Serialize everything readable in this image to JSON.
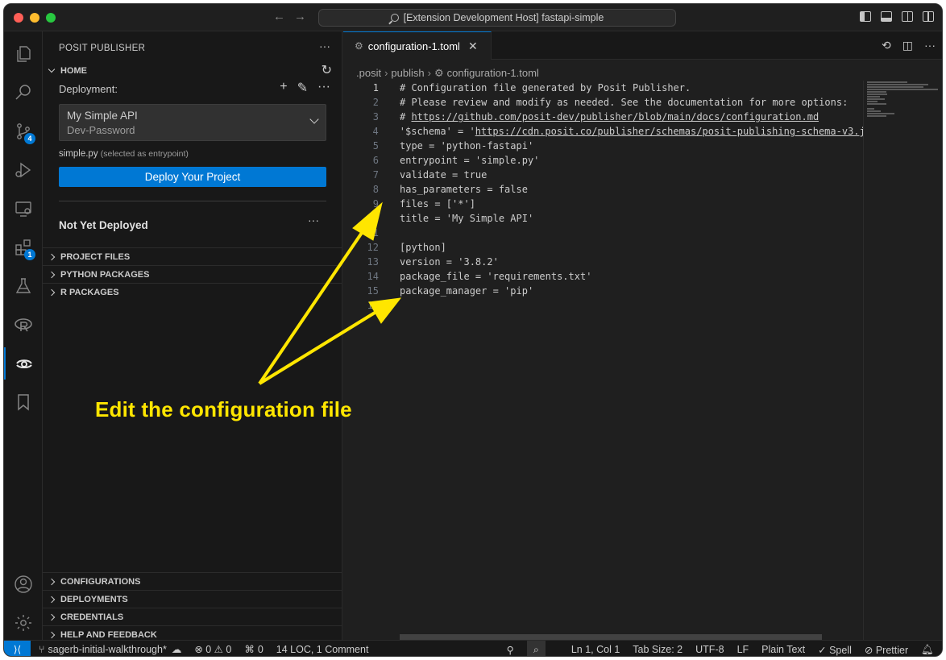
{
  "titlebar": {
    "title": "[Extension Development Host] fastapi-simple",
    "back_icon": "arrow-left-icon",
    "forward_icon": "arrow-right-icon"
  },
  "activity_bar": {
    "items": [
      {
        "icon": "explorer-icon"
      },
      {
        "icon": "search-icon"
      },
      {
        "icon": "source-control-icon",
        "badge": "4"
      },
      {
        "icon": "run-debug-icon"
      },
      {
        "icon": "remote-explorer-icon"
      },
      {
        "icon": "extensions-icon",
        "badge": "1"
      },
      {
        "icon": "testing-icon"
      },
      {
        "icon": "r-icon"
      },
      {
        "icon": "posit-publisher-icon"
      },
      {
        "icon": "bookmark-icon"
      }
    ],
    "bottom": [
      {
        "icon": "account-icon"
      },
      {
        "icon": "settings-gear-icon"
      }
    ]
  },
  "sidebar": {
    "title": "POSIT PUBLISHER",
    "home": {
      "label": "HOME",
      "deployment_label": "Deployment:",
      "selected_deployment": {
        "name": "My Simple API",
        "credential": "Dev-Password"
      },
      "entrypoint_file": "simple.py",
      "entrypoint_note": "(selected as entrypoint)",
      "deploy_button": "Deploy Your Project",
      "status": "Not Yet Deployed"
    },
    "sections_top": [
      "PROJECT FILES",
      "PYTHON PACKAGES",
      "R PACKAGES"
    ],
    "sections_bottom": [
      "CONFIGURATIONS",
      "DEPLOYMENTS",
      "CREDENTIALS",
      "HELP AND FEEDBACK"
    ]
  },
  "editor": {
    "tab": {
      "label": "configuration-1.toml"
    },
    "breadcrumb": [
      ".posit",
      "publish",
      "configuration-1.toml"
    ],
    "lines": [
      "# Configuration file generated by Posit Publisher.",
      "# Please review and modify as needed. See the documentation for more options:",
      "# https://github.com/posit-dev/publisher/blob/main/docs/configuration.md",
      "'$schema' = 'https://cdn.posit.co/publisher/schemas/posit-publishing-schema-v3.j",
      "type = 'python-fastapi'",
      "entrypoint = 'simple.py'",
      "validate = true",
      "has_parameters = false",
      "files = ['*']",
      "title = 'My Simple API'",
      "",
      "[python]",
      "version = '3.8.2'",
      "package_file = 'requirements.txt'",
      "package_manager = 'pip'",
      ""
    ],
    "current_line": 1
  },
  "statusbar": {
    "branch": "sagerb-initial-walkthrough*",
    "problems": "⊗ 0 ⚠ 0",
    "ports": "0",
    "loc": "14 LOC, 1 Comment",
    "cursor": "Ln 1, Col 1",
    "tab_size": "Tab Size: 2",
    "encoding": "UTF-8",
    "eol": "LF",
    "language": "Plain Text",
    "spell": "Spell",
    "prettier": "Prettier"
  },
  "annotation": {
    "text": "Edit the configuration file",
    "color": "#ffe600"
  }
}
